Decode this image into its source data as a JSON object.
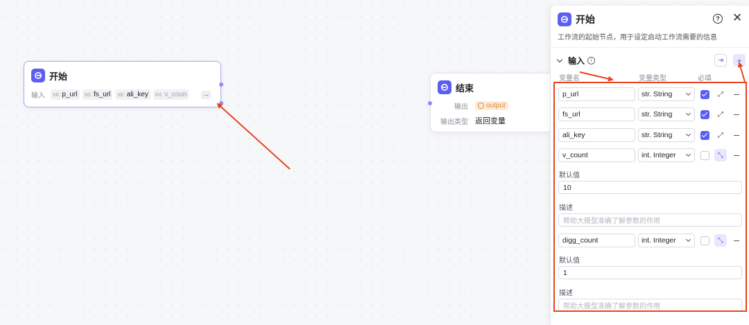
{
  "canvas": {
    "start_node": {
      "title": "开始",
      "input_label": "输入",
      "params": [
        {
          "type": "str.",
          "name": "p_url"
        },
        {
          "type": "str.",
          "name": "fs_url"
        },
        {
          "type": "str.",
          "name": "ali_key"
        },
        {
          "type": "int.",
          "name": "v_coun"
        }
      ],
      "more": "···"
    },
    "end_node": {
      "title": "结束",
      "output_label": "输出",
      "output_var": "output",
      "output_type_label": "输出类型",
      "output_type_value": "返回变量"
    }
  },
  "panel": {
    "title": "开始",
    "help": "?",
    "close": "✕",
    "description": "工作流的起始节点，用于设定启动工作流需要的信息",
    "section": {
      "title": "输入",
      "info": "i",
      "import_glyph": "⇥",
      "add_glyph": "+"
    },
    "columns": {
      "name": "变量名",
      "type": "变量类型",
      "required": "必填"
    },
    "rows": [
      {
        "name": "p_url",
        "type": "str. String",
        "required": true
      },
      {
        "name": "fs_url",
        "type": "str. String",
        "required": true
      },
      {
        "name": "ali_key",
        "type": "str. String",
        "required": true
      },
      {
        "name": "v_count",
        "type": "int. Integer",
        "required": false,
        "default_label": "默认值",
        "default_value": "10",
        "desc_label": "描述",
        "desc_placeholder": "帮助大模型准确了解参数的作用"
      },
      {
        "name": "digg_count",
        "type": "int. Integer",
        "required": false,
        "default_label": "默认值",
        "default_value": "1",
        "desc_label": "描述",
        "desc_placeholder": "帮助大模型准确了解参数的作用"
      }
    ]
  },
  "colors": {
    "accent": "#5b5ef0",
    "annotation": "#e8431e",
    "output_chip": "#fdebd7"
  }
}
